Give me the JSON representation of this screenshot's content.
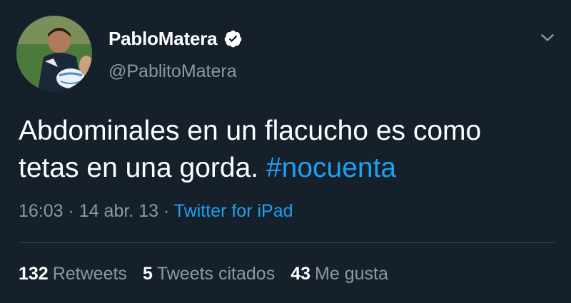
{
  "tweet": {
    "display_name": "PabloMatera",
    "handle": "@PablitoMatera",
    "text_line1": "Abdominales en un flacucho es como",
    "text_line2_plain": "tetas en una gorda. ",
    "hashtag": "#nocuenta",
    "time": "16:03",
    "separator": "·",
    "date": "14 abr. 13",
    "source": "Twitter for iPad"
  },
  "stats": {
    "retweets_count": "132",
    "retweets_label": "Retweets",
    "quotes_count": "5",
    "quotes_label": "Tweets citados",
    "likes_count": "43",
    "likes_label": "Me gusta"
  },
  "icons": {
    "verified": "verified-badge-icon",
    "caret": "chevron-down-icon"
  },
  "colors": {
    "background": "#15202b",
    "accent": "#1da1f2",
    "secondary_text": "#8899a6",
    "primary_text": "#ffffff",
    "divider": "#38444d"
  }
}
